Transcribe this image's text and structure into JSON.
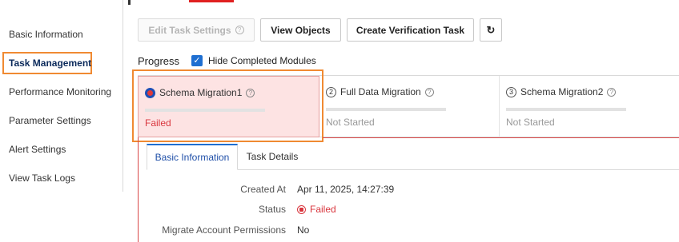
{
  "sidebar": {
    "items": [
      {
        "label": "Basic Information"
      },
      {
        "label": "Task Management"
      },
      {
        "label": "Performance Monitoring"
      },
      {
        "label": "Parameter Settings"
      },
      {
        "label": "Alert Settings"
      },
      {
        "label": "View Task Logs"
      }
    ],
    "active_index": 1
  },
  "toolbar": {
    "edit_label": "Edit Task Settings",
    "view_objects_label": "View Objects",
    "create_verification_label": "Create Verification Task",
    "refresh_icon": "refresh-icon"
  },
  "progress": {
    "title": "Progress",
    "hide_completed_label": "Hide Completed Modules",
    "hide_completed_checked": true
  },
  "modules": [
    {
      "step": "",
      "name": "Schema Migration1",
      "status": "Failed"
    },
    {
      "step": "2",
      "name": "Full Data Migration",
      "status": "Not Started"
    },
    {
      "step": "3",
      "name": "Schema Migration2",
      "status": "Not Started"
    }
  ],
  "tabs": [
    {
      "label": "Basic Information"
    },
    {
      "label": "Task Details"
    }
  ],
  "details": {
    "created_at_label": "Created At",
    "created_at_value": "Apr 11, 2025, 14:27:39",
    "status_label": "Status",
    "status_value": "Failed",
    "migrate_account_label": "Migrate Account Permissions",
    "migrate_account_value": "No"
  },
  "colors": {
    "accent": "#1f6fd1",
    "highlight": "#f08a32",
    "failed": "#d9363e"
  }
}
